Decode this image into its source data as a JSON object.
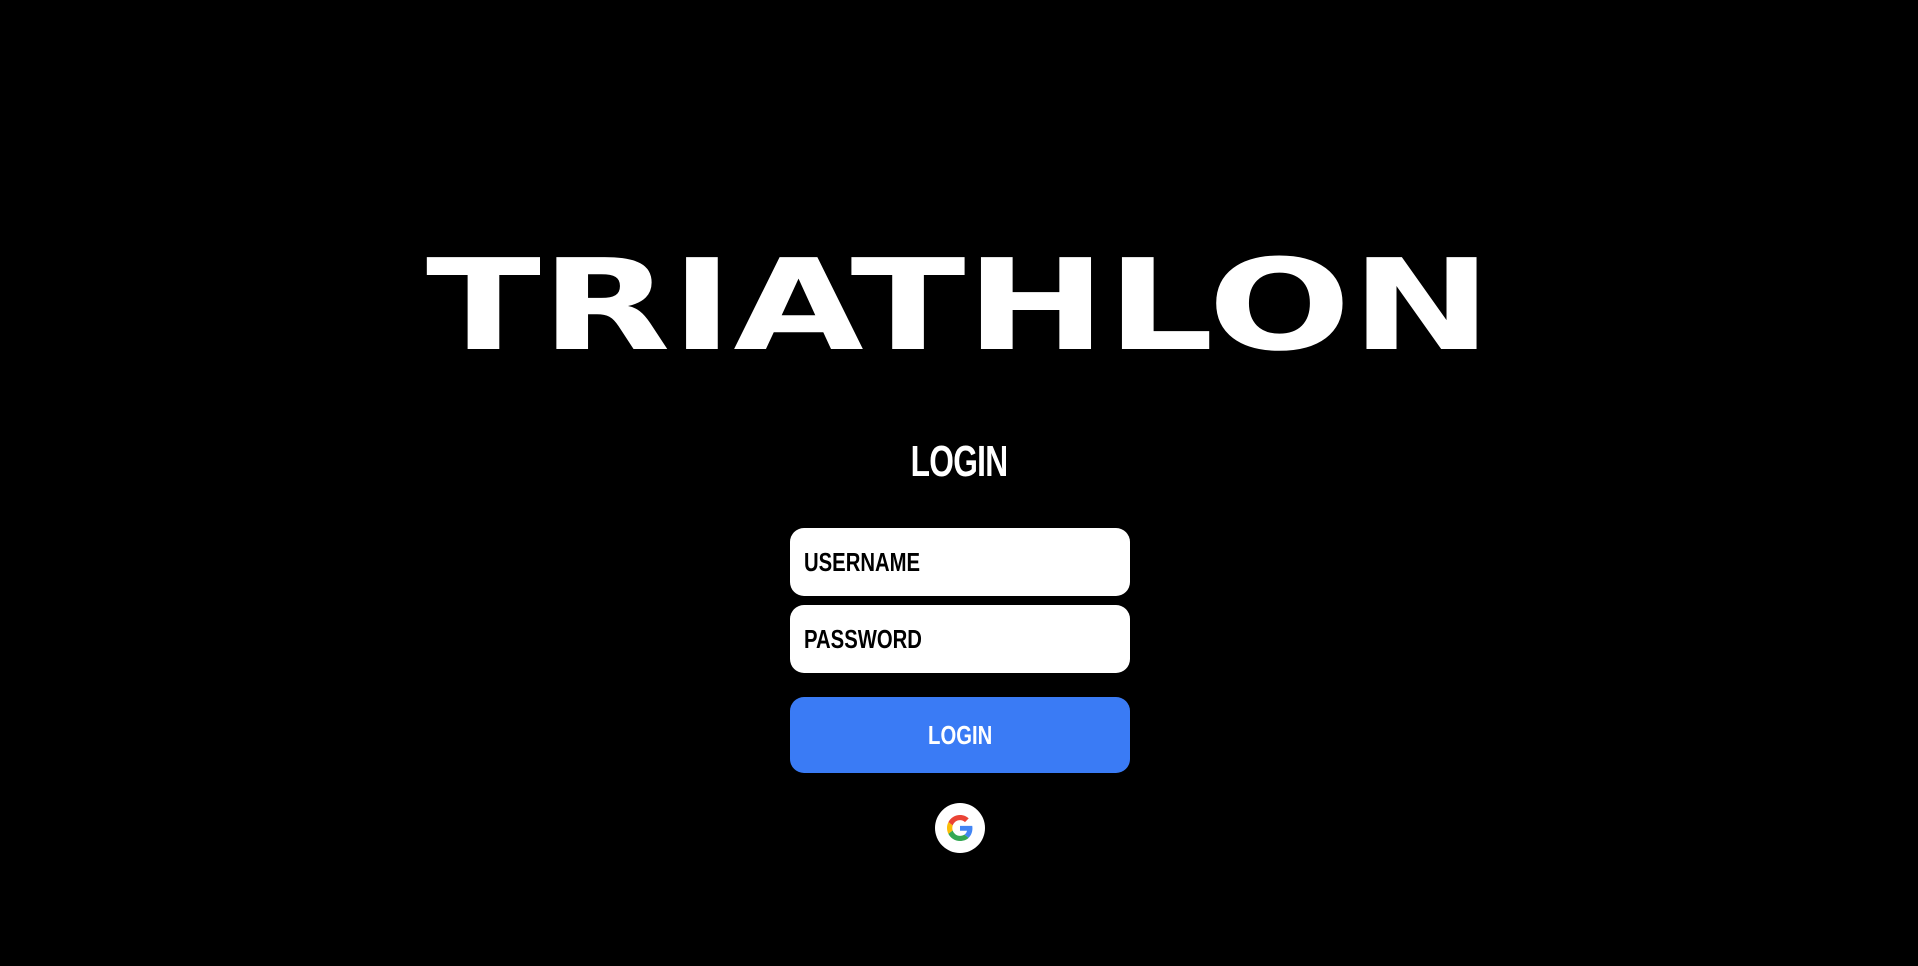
{
  "brand": {
    "title": "TRIATHLON"
  },
  "login_form": {
    "heading": "LOGIN",
    "username_placeholder": "USERNAME",
    "password_placeholder": "PASSWORD",
    "submit_label": "LOGIN",
    "google_icon": "google-icon"
  },
  "colors": {
    "background": "#000000",
    "text": "#ffffff",
    "field_background": "#ffffff",
    "accent": "#3a7bf5"
  }
}
